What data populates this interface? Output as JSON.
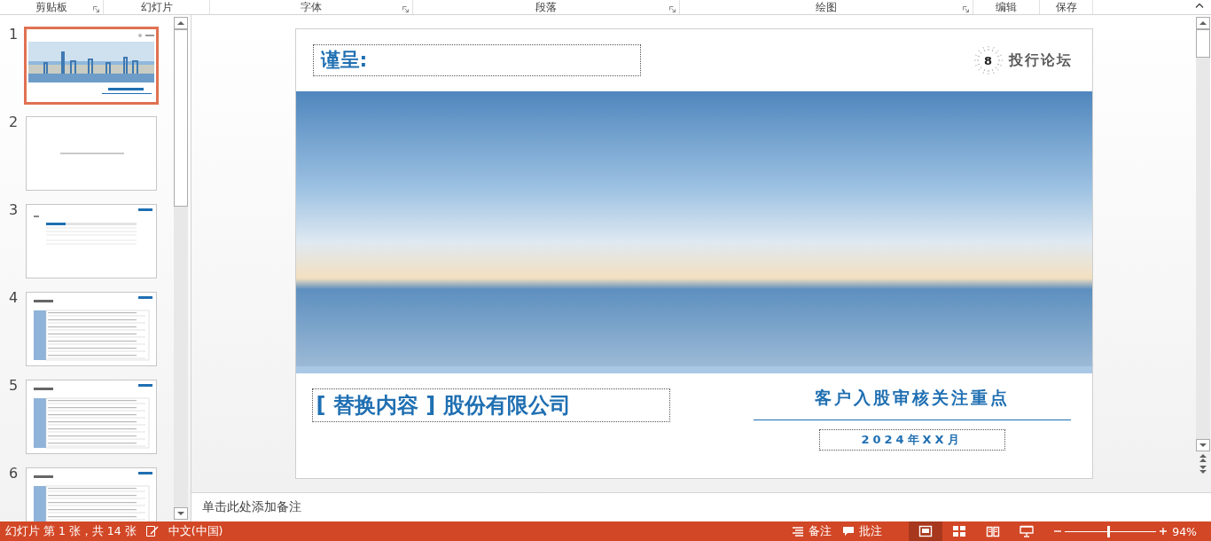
{
  "ribbon": {
    "groups": [
      {
        "label": "剪贴板",
        "launcher": true
      },
      {
        "label": "幻灯片",
        "launcher": false
      },
      {
        "label": "字体",
        "launcher": true
      },
      {
        "label": "段落",
        "launcher": true
      },
      {
        "label": "绘图",
        "launcher": true
      },
      {
        "label": "编辑",
        "launcher": false
      },
      {
        "label": "保存",
        "launcher": false
      }
    ]
  },
  "thumbnails": [
    {
      "number": "1",
      "kind": "cover",
      "selected": true
    },
    {
      "number": "2",
      "kind": "section",
      "selected": false
    },
    {
      "number": "3",
      "kind": "toc",
      "selected": false
    },
    {
      "number": "4",
      "kind": "table",
      "selected": false
    },
    {
      "number": "5",
      "kind": "table",
      "selected": false
    },
    {
      "number": "6",
      "kind": "table",
      "selected": false
    }
  ],
  "slide": {
    "addressee": "谨呈:",
    "logo_badge": "8",
    "logo_text": "投行论坛",
    "company": "[ 替换内容 ] 股份有限公司",
    "title": "客户入股审核关注重点",
    "date": "2024年XX月"
  },
  "notes": {
    "placeholder": "单击此处添加备注"
  },
  "status_bar": {
    "slide_info": "幻灯片 第 1 张，共 14 张",
    "language": "中文(中国)",
    "notes_button": "备注",
    "comments_button": "批注",
    "views": [
      {
        "kind": "normal",
        "selected": true
      },
      {
        "kind": "sorter",
        "selected": false
      },
      {
        "kind": "reading",
        "selected": false
      },
      {
        "kind": "show",
        "selected": false
      }
    ],
    "zoom": {
      "level": 0.47,
      "reading": "94%"
    }
  }
}
